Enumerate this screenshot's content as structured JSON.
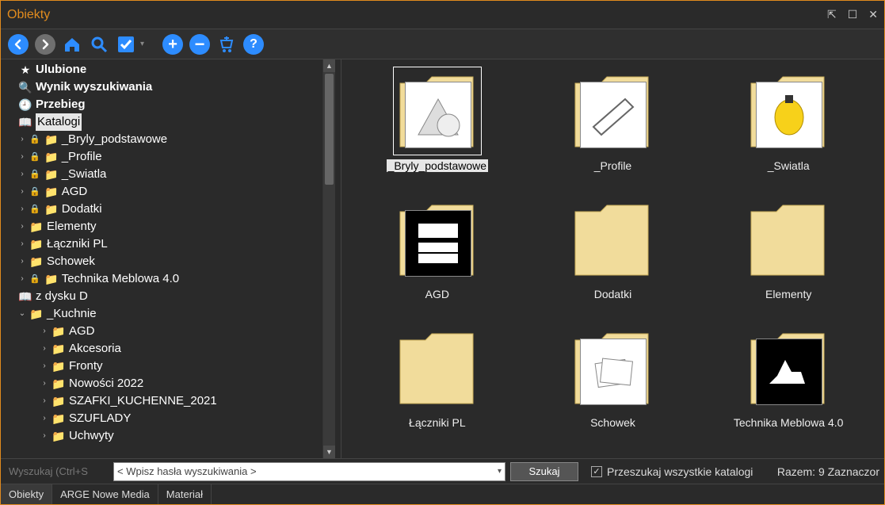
{
  "window": {
    "title": "Obiekty"
  },
  "toolbar_icons": [
    "back",
    "forward",
    "home",
    "search",
    "check",
    "add",
    "remove",
    "cart",
    "help"
  ],
  "tree": {
    "favorites": "Ulubione",
    "search_result": "Wynik wyszukiwania",
    "history": "Przebieg",
    "catalogs": "Katalogi",
    "from_disk": "z dysku D",
    "catalog_items": [
      {
        "label": "_Bryly_podstawowe",
        "locked": true
      },
      {
        "label": "_Profile",
        "locked": true
      },
      {
        "label": "_Swiatla",
        "locked": true
      },
      {
        "label": "AGD",
        "locked": true
      },
      {
        "label": "Dodatki",
        "locked": true
      },
      {
        "label": "Elementy",
        "locked": false
      },
      {
        "label": "Łączniki PL",
        "locked": false
      },
      {
        "label": "Schowek",
        "locked": false
      },
      {
        "label": "Technika Meblowa 4.0",
        "locked": true
      }
    ],
    "kuchnie": "_Kuchnie",
    "kuchnie_items": [
      "AGD",
      "Akcesoria",
      "Fronty",
      "Nowości 2022",
      "SZAFKI_KUCHENNE_2021",
      "SZUFLADY",
      "Uchwyty"
    ]
  },
  "grid": [
    {
      "label": "_Bryly_podstawowe",
      "kind": "shapes",
      "selected": true
    },
    {
      "label": "_Profile",
      "kind": "profile"
    },
    {
      "label": "_Swiatla",
      "kind": "bulb"
    },
    {
      "label": "AGD",
      "kind": "kitchen"
    },
    {
      "label": "Dodatki",
      "kind": "empty"
    },
    {
      "label": "Elementy",
      "kind": "empty"
    },
    {
      "label": "Łączniki PL",
      "kind": "empty"
    },
    {
      "label": "Schowek",
      "kind": "papers"
    },
    {
      "label": "Technika Meblowa 4.0",
      "kind": "plane"
    }
  ],
  "search": {
    "disabled_hint": "Wyszukaj (Ctrl+S",
    "combo_text": "< Wpisz hasła wyszukiwania >",
    "button": "Szukaj",
    "checkbox": "Przeszukaj wszystkie katalogi"
  },
  "status": {
    "right": "Razem: 9 Zaznaczor"
  },
  "tabs": [
    "Obiekty",
    "ARGE Nowe Media",
    "Materiał"
  ]
}
